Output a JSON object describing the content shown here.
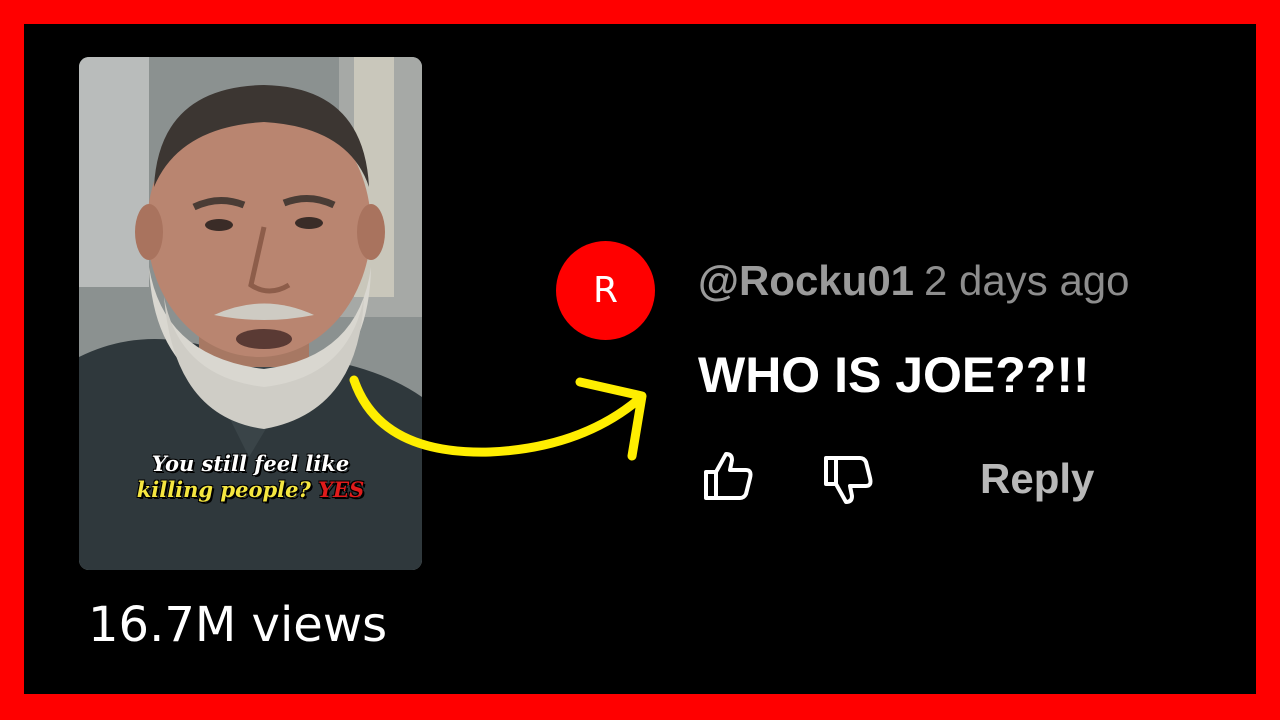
{
  "thumbnail": {
    "caption_line1": "You still feel like",
    "caption_line2": "killing people?",
    "caption_answer": "YES"
  },
  "view_count": "16.7M views",
  "comment": {
    "avatar_letter": "R",
    "username": "@Rocku01",
    "timestamp": "2 days ago",
    "text": "WHO IS JOE??!!",
    "reply_label": "Reply"
  },
  "icons": {
    "like": "thumbs-up-icon",
    "dislike": "thumbs-down-icon",
    "arrow": "curved-arrow"
  },
  "colors": {
    "border": "#ff0000",
    "background": "#000000",
    "avatar": "#ff0000",
    "arrow": "#ffee00",
    "caption_highlight": "#f5e640",
    "caption_answer": "#e01b1b"
  }
}
